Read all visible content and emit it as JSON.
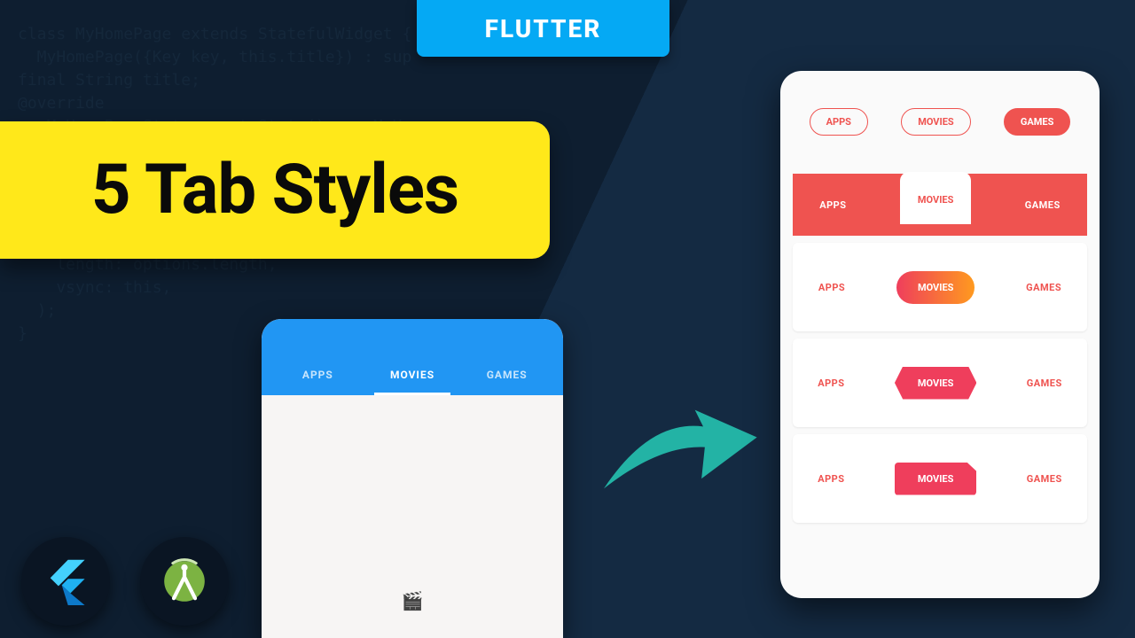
{
  "badge": {
    "label": "FLUTTER"
  },
  "title": {
    "text": "5 Tab Styles"
  },
  "colors": {
    "flutter_blue": "#05a9f4",
    "material_blue": "#2196f3",
    "yellow": "#ffe81a",
    "red": "#ef5350",
    "teal": "#23b3a5"
  },
  "tabs": {
    "items": [
      "APPS",
      "MOVIES",
      "GAMES"
    ],
    "t0": "APPS",
    "t1": "MOVIES",
    "t2": "GAMES"
  },
  "left_phone": {
    "active_index": 1,
    "body_icon": "clapper-icon"
  },
  "styles": [
    {
      "name": "outlined-pills",
      "active_index": 2
    },
    {
      "name": "raised-segment",
      "active_index": 1
    },
    {
      "name": "gradient-pill",
      "active_index": 1
    },
    {
      "name": "hexagon-chip",
      "active_index": 1
    },
    {
      "name": "rect-chip",
      "active_index": 1
    }
  ],
  "tool_icons": [
    "flutter-logo",
    "android-studio-logo"
  ]
}
